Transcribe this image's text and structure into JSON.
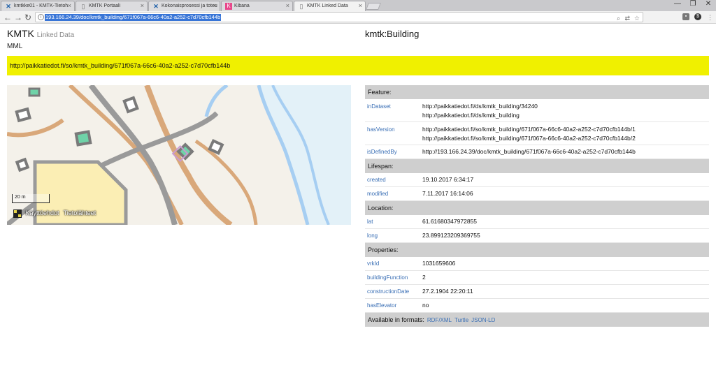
{
  "browser": {
    "tabs": [
      {
        "title": "kmtkke01 - KMTK-Tietoh",
        "icon": "x-logo-icon",
        "active": false
      },
      {
        "title": "KMTK Portaali",
        "icon": "page-icon",
        "active": false
      },
      {
        "title": "Kokonaisprosessi ja toteu",
        "icon": "x-logo-icon",
        "active": false
      },
      {
        "title": "Kibana",
        "icon": "kibana-icon",
        "active": false
      },
      {
        "title": "KMTK Linked Data",
        "icon": "page-icon",
        "active": true
      }
    ],
    "tab_close": "×",
    "window_buttons": {
      "minimize": "—",
      "maximize": "❐",
      "close": "✕"
    },
    "address": "193.166.24.39/doc/kmtk_building/671f067a-66c6-40a2-a252-c7d70cfb144b",
    "nav": {
      "back": "←",
      "forward": "→",
      "reload": "↻"
    }
  },
  "header": {
    "brand": "KMTK",
    "brand_sub": "Linked Data",
    "org": "MML",
    "resource_type": "kmtk:Building"
  },
  "uri": "http://paikkatiedot.fi/so/kmtk_building/671f067a-66c6-40a2-a252-c7d70cfb144b",
  "map": {
    "scale_label": "20 m",
    "attribution": {
      "terms": "Käyttöehdot",
      "sources": "Tietolähteet"
    },
    "colors": {
      "water": "#a6cef2",
      "water_fill": "#e3f1f8",
      "road": "#d9a87a",
      "railway": "#9a9a9a",
      "building": "#7a7a7a",
      "highlight": "#c99ad0"
    }
  },
  "sections": [
    {
      "title": "Feature:",
      "rows": [
        {
          "key": "inDataset",
          "values": [
            "http://paikkatiedot.fi/ds/kmtk_building/34240",
            "http://paikkatiedot.fi/ds/kmtk_building"
          ]
        },
        {
          "key": "hasVersion",
          "values": [
            "http://paikkatiedot.fi/so/kmtk_building/671f067a-66c6-40a2-a252-c7d70cfb144b/1",
            "http://paikkatiedot.fi/so/kmtk_building/671f067a-66c6-40a2-a252-c7d70cfb144b/2"
          ]
        },
        {
          "key": "isDefinedBy",
          "values": [
            "http://193.166.24.39/doc/kmtk_building/671f067a-66c6-40a2-a252-c7d70cfb144b"
          ]
        }
      ]
    },
    {
      "title": "Lifespan:",
      "rows": [
        {
          "key": "created",
          "values": [
            "19.10.2017 6:34:17"
          ]
        },
        {
          "key": "modified",
          "values": [
            "7.11.2017 16:14:06"
          ]
        }
      ]
    },
    {
      "title": "Location:",
      "rows": [
        {
          "key": "lat",
          "values": [
            "61.61680347972855"
          ]
        },
        {
          "key": "long",
          "values": [
            "23.899123209369755"
          ]
        }
      ]
    },
    {
      "title": "Properties:",
      "rows": [
        {
          "key": "vrkId",
          "values": [
            "1031659606"
          ]
        },
        {
          "key": "buildingFunction",
          "values": [
            "2"
          ]
        },
        {
          "key": "constructionDate",
          "values": [
            "27.2.1904 22:20:11"
          ]
        },
        {
          "key": "hasElevator",
          "values": [
            "no"
          ]
        }
      ]
    }
  ],
  "formats": {
    "label": "Available in formats:",
    "links": [
      "RDF/XML",
      "Turtle",
      "JSON-LD"
    ]
  }
}
